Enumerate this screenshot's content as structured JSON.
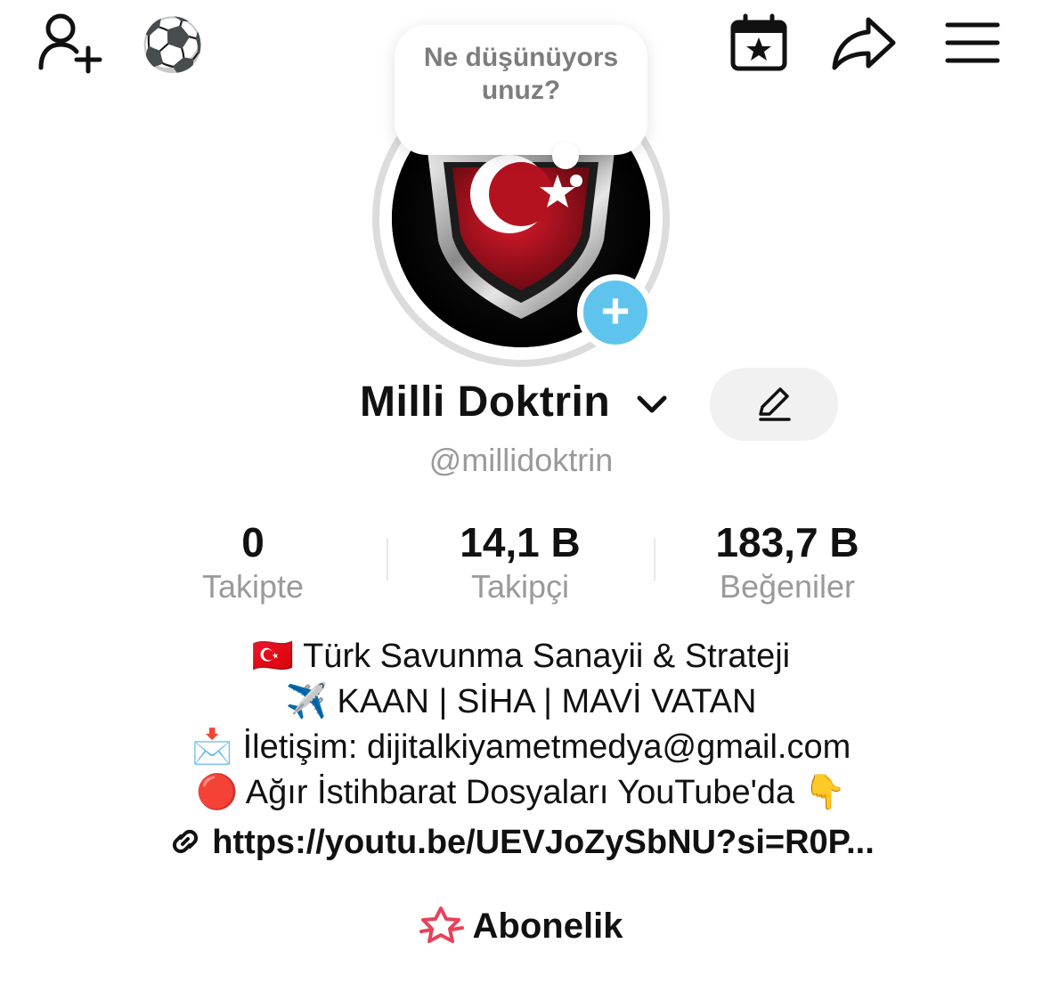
{
  "header": {
    "add_user_icon": "person-plus-icon",
    "interest_emoji": "⚽",
    "calendar_icon": "calendar-star-icon",
    "share_icon": "share-arrow-icon",
    "menu_icon": "hamburger-menu-icon"
  },
  "bubble": {
    "text": "Ne düşünüyorsunuz?"
  },
  "profile": {
    "avatar_icon": "turkish-flag-shield-avatar",
    "add_story_symbol": "+",
    "name": "Milli Doktrin",
    "username": "@millidoktrin"
  },
  "stats": [
    {
      "value": "0",
      "label": "Takipte"
    },
    {
      "value": "14,1 B",
      "label": "Takipçi"
    },
    {
      "value": "183,7 B",
      "label": "Beğeniler"
    }
  ],
  "bio": {
    "lines": [
      {
        "emoji": "🇹🇷",
        "text": "Türk Savunma Sanayii & Strateji"
      },
      {
        "emoji": "✈️",
        "text": "KAAN | SİHA | MAVİ VATAN"
      },
      {
        "emoji": "📩",
        "text": "İletişim: dijitalkiyametmedya@gmail.com"
      },
      {
        "emoji": "🔴",
        "text": "Ağır İstihbarat Dosyaları YouTube'da",
        "trailing_emoji": "👇"
      }
    ],
    "link": "https://youtu.be/UEVJoZySbNU?si=R0P..."
  },
  "subscription": {
    "label": "Abonelik"
  },
  "colors": {
    "add_story": "#5ec4ee",
    "subscription_icon": "#e8425a",
    "flag_red": "#c8102e"
  }
}
